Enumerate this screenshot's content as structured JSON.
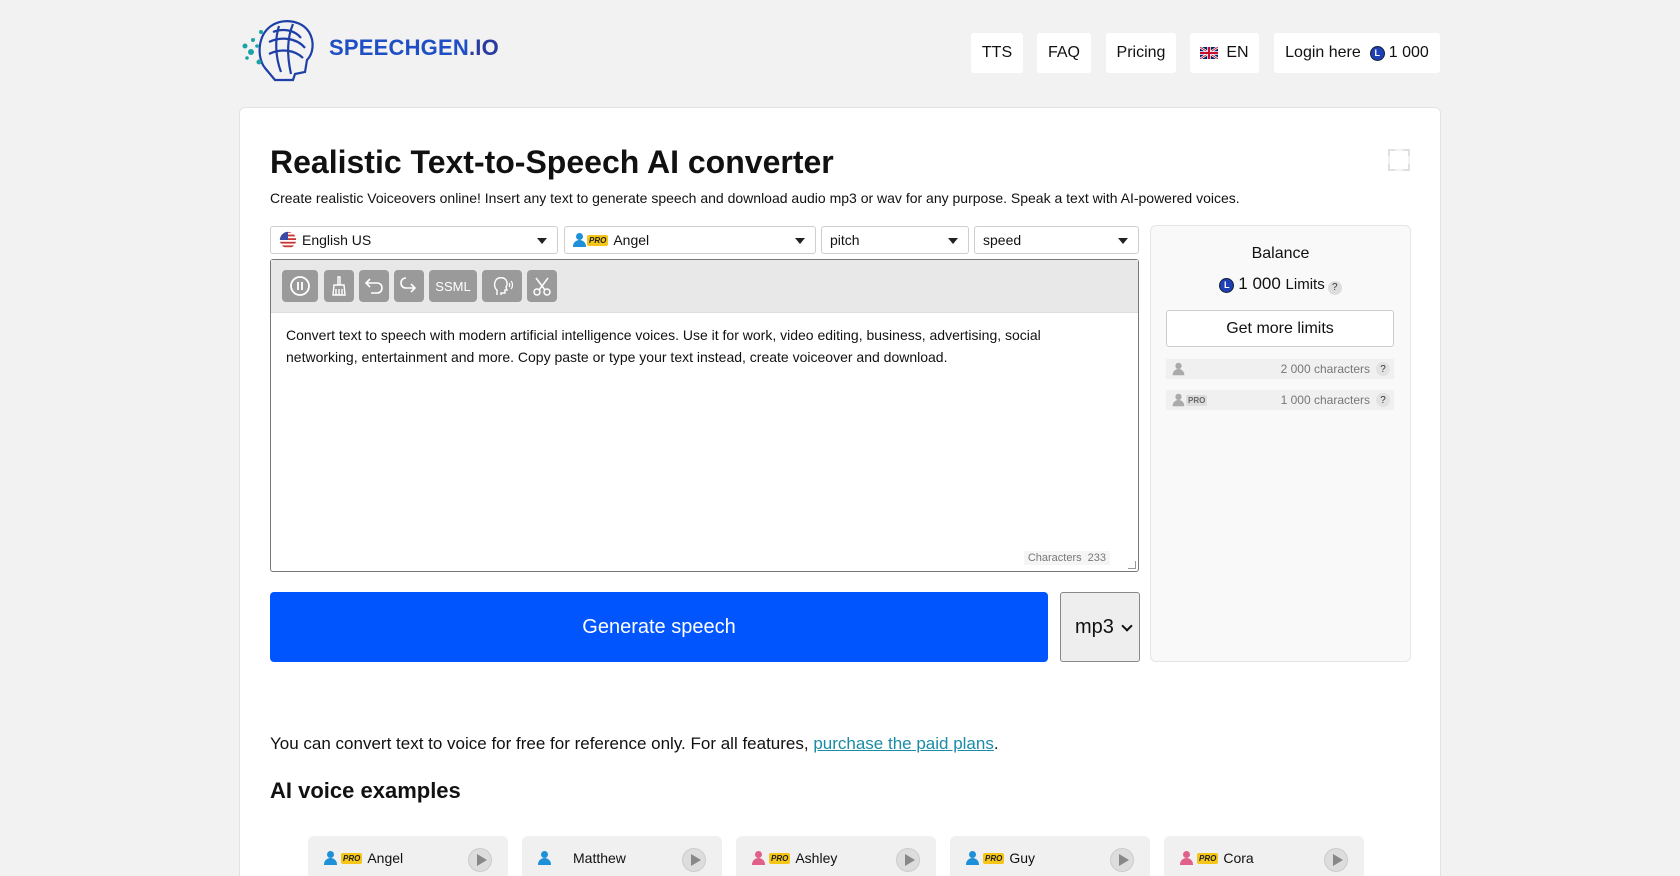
{
  "logo": {
    "name": "SPEECHGEN",
    "tld": ".IO"
  },
  "nav": {
    "tts": "TTS",
    "faq": "FAQ",
    "pricing": "Pricing",
    "language": "EN",
    "login": "Login here",
    "coin_glyph": "L",
    "balance": "1 000"
  },
  "main": {
    "title": "Realistic Text-to-Speech AI converter",
    "subtitle": "Create realistic Voiceovers online! Insert any text to generate speech and download audio mp3 or wav for any purpose. Speak a text with AI-powered voices.",
    "language_select": "English US",
    "voice_select": "Angel",
    "pro_label": "PRO",
    "pitch_select": "pitch",
    "speed_select": "speed",
    "ssml_label": "SSML",
    "editor_text": "Convert text to speech with modern artificial intelligence voices. Use it for work, video editing, business, advertising, social networking, entertainment and more. Copy paste or type your text instead, create voiceover and download.",
    "characters_label": "Characters",
    "characters_count": "233",
    "generate_label": "Generate speech",
    "format_value": "mp3",
    "free_note_prefix": "You can convert text to voice for free for reference only. For all features, ",
    "free_note_link": "purchase the paid plans",
    "free_note_suffix": ".",
    "examples_title": "AI voice examples"
  },
  "balance": {
    "title": "Balance",
    "amount": "1 000",
    "limits_label": "Limits",
    "help": "?",
    "get_more": "Get more limits",
    "free_limit": "2 000 characters",
    "pro_limit": "1 000 characters"
  },
  "voices": [
    {
      "name": "Angel",
      "pro": true,
      "gender": "male"
    },
    {
      "name": "Matthew",
      "pro": false,
      "gender": "male"
    },
    {
      "name": "Ashley",
      "pro": true,
      "gender": "female"
    },
    {
      "name": "Guy",
      "pro": true,
      "gender": "male"
    },
    {
      "name": "Cora",
      "pro": true,
      "gender": "female"
    }
  ],
  "colors": {
    "accent": "#0055ff",
    "link": "#1a8ca5",
    "male_icon": "#1e90d8",
    "female_icon": "#e0608a",
    "pro_badge": "#f5c518"
  }
}
